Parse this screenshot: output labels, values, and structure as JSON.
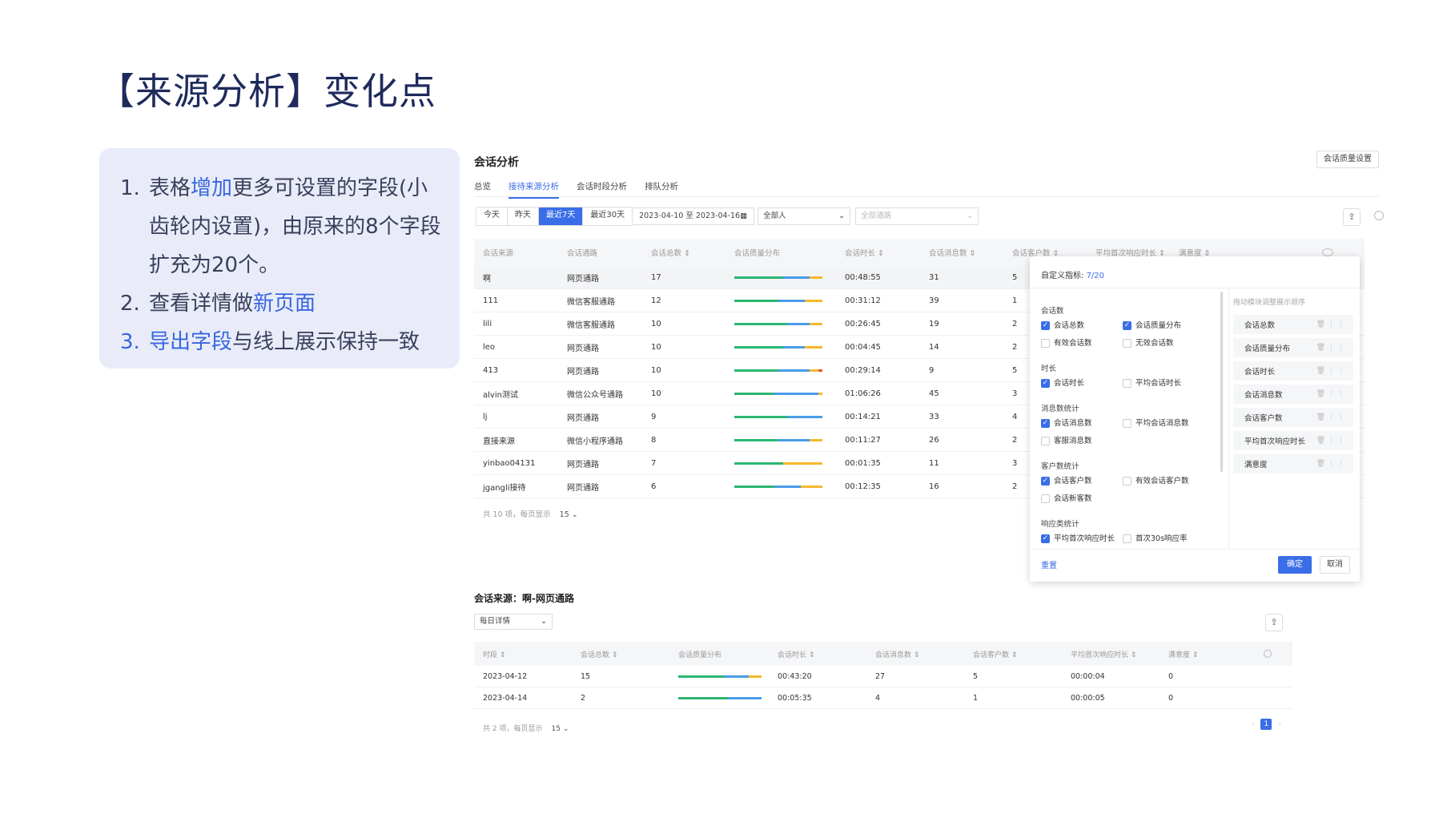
{
  "slide": {
    "title": "【来源分析】变化点",
    "notes": [
      {
        "num": "1.",
        "pre": "表格",
        "hl": "增加",
        "post": "更多可设置的字段(小齿轮内设置)，由原来的8个字段扩充为20个。"
      },
      {
        "num": "2.",
        "pre": "查看详情做",
        "hl": "新页面",
        "post": ""
      },
      {
        "num": "3.",
        "pre": "",
        "hl": "导出字段",
        "post": "与线上展示保持一致"
      }
    ]
  },
  "app": {
    "title": "会话分析",
    "quality_button": "会话质量设置",
    "tabs": [
      "总览",
      "接待来源分析",
      "会话时段分析",
      "排队分析"
    ],
    "active_tab": 1,
    "date_buttons": [
      "今天",
      "昨天",
      "最近7天",
      "最近30天"
    ],
    "date_range": "2023-04-10 至 2023-04-16",
    "person_select": "全部人",
    "channel_select_placeholder": "全部通路",
    "columns": [
      "会话来源",
      "会话通路",
      "会话总数 ⇕",
      "会话质量分布",
      "会话时长 ⇕",
      "会话消息数 ⇕",
      "会话客户数 ⇕",
      "平均首次响应时长 ⇕",
      "满意度 ⇕"
    ],
    "rows": [
      {
        "source": "啊",
        "channel": "网页通路",
        "total": "17",
        "quality": [
          0.55,
          0.3,
          0.15,
          0
        ],
        "duration": "00:48:55",
        "messages": "31",
        "customers": "5"
      },
      {
        "source": "111",
        "channel": "微信客服通路",
        "total": "12",
        "quality": [
          0.5,
          0.3,
          0.2,
          0
        ],
        "duration": "00:31:12",
        "messages": "39",
        "customers": "1"
      },
      {
        "source": "lili",
        "channel": "微信客服通路",
        "total": "10",
        "quality": [
          0.6,
          0.25,
          0.15,
          0
        ],
        "duration": "00:26:45",
        "messages": "19",
        "customers": "2"
      },
      {
        "source": "leo",
        "channel": "网页通路",
        "total": "10",
        "quality": [
          0.55,
          0.25,
          0.2,
          0
        ],
        "duration": "00:04:45",
        "messages": "14",
        "customers": "2"
      },
      {
        "source": "413",
        "channel": "网页通路",
        "total": "10",
        "quality": [
          0.5,
          0.35,
          0.1,
          0.05
        ],
        "duration": "00:29:14",
        "messages": "9",
        "customers": "5"
      },
      {
        "source": "alvin测试",
        "channel": "微信公众号通路",
        "total": "10",
        "quality": [
          0.45,
          0.5,
          0.05,
          0
        ],
        "duration": "01:06:26",
        "messages": "45",
        "customers": "3"
      },
      {
        "source": "lj",
        "channel": "网页通路",
        "total": "9",
        "quality": [
          0.6,
          0.4,
          0,
          0
        ],
        "duration": "00:14:21",
        "messages": "33",
        "customers": "4"
      },
      {
        "source": "直接来源",
        "channel": "微信小程序通路",
        "total": "8",
        "quality": [
          0.5,
          0.35,
          0.15,
          0
        ],
        "duration": "00:11:27",
        "messages": "26",
        "customers": "2"
      },
      {
        "source": "yinbao04131",
        "channel": "网页通路",
        "total": "7",
        "quality": [
          0.55,
          0,
          0.45,
          0
        ],
        "duration": "00:01:35",
        "messages": "11",
        "customers": "3"
      },
      {
        "source": "jgangli接待",
        "channel": "网页通路",
        "total": "6",
        "quality": [
          0.45,
          0.3,
          0.25,
          0
        ],
        "duration": "00:12:35",
        "messages": "16",
        "customers": "2"
      }
    ],
    "footer": "共 10 项，每页显示",
    "page_size": "15 ⌄"
  },
  "panel": {
    "title_prefix": "自定义指标:",
    "count": "7/20",
    "groups": [
      {
        "title": "会话数",
        "options": [
          {
            "label": "会话总数",
            "checked": true
          },
          {
            "label": "会话质量分布",
            "checked": true
          },
          {
            "label": "有效会话数",
            "checked": false
          },
          {
            "label": "无效会话数",
            "checked": false
          }
        ]
      },
      {
        "title": "时长",
        "options": [
          {
            "label": "会话时长",
            "checked": true
          },
          {
            "label": "平均会话时长",
            "checked": false
          }
        ]
      },
      {
        "title": "消息数统计",
        "options": [
          {
            "label": "会话消息数",
            "checked": true
          },
          {
            "label": "平均会话消息数",
            "checked": false
          },
          {
            "label": "客服消息数",
            "checked": false
          }
        ]
      },
      {
        "title": "客户数统计",
        "options": [
          {
            "label": "会话客户数",
            "checked": true
          },
          {
            "label": "有效会话客户数",
            "checked": false
          },
          {
            "label": "会话新客数",
            "checked": false
          }
        ]
      },
      {
        "title": "响应类统计",
        "options": [
          {
            "label": "平均首次响应时长",
            "checked": true
          },
          {
            "label": "首次30s响应率",
            "checked": false
          }
        ]
      }
    ],
    "right_title": "拖动模块调整展示顺序",
    "ordered": [
      "会话总数",
      "会话质量分布",
      "会话时长",
      "会话消息数",
      "会话客户数",
      "平均首次响应时长",
      "满意度"
    ],
    "reset": "重置",
    "ok": "确定",
    "cancel": "取消"
  },
  "detail": {
    "title": "会话来源：啊-网页通路",
    "select": "每日详情",
    "columns": [
      "时段 ⇕",
      "会话总数 ⇕",
      "会话质量分布",
      "会话时长 ⇕",
      "会话消息数 ⇕",
      "会话客户数 ⇕",
      "平均首次响应时长 ⇕",
      "满意度 ⇕"
    ],
    "rows": [
      {
        "date": "2023-04-12",
        "total": "15",
        "quality": [
          0.55,
          0.3,
          0.15,
          0
        ],
        "duration": "00:43:20",
        "messages": "27",
        "customers": "5",
        "first_resp": "00:00:04",
        "satisfaction": "0"
      },
      {
        "date": "2023-04-14",
        "total": "2",
        "quality": [
          0.6,
          0.4,
          0,
          0
        ],
        "duration": "00:05:35",
        "messages": "4",
        "customers": "1",
        "first_resp": "00:00:05",
        "satisfaction": "0"
      }
    ],
    "footer": "共 2 项，每页显示",
    "page_size": "15 ⌄",
    "page": "1"
  },
  "colors": {
    "accent": "#3a6ee8",
    "green": "#2bb673",
    "blue": "#4a9ce8",
    "yellow": "#f5b82e",
    "red": "#e8553a"
  }
}
